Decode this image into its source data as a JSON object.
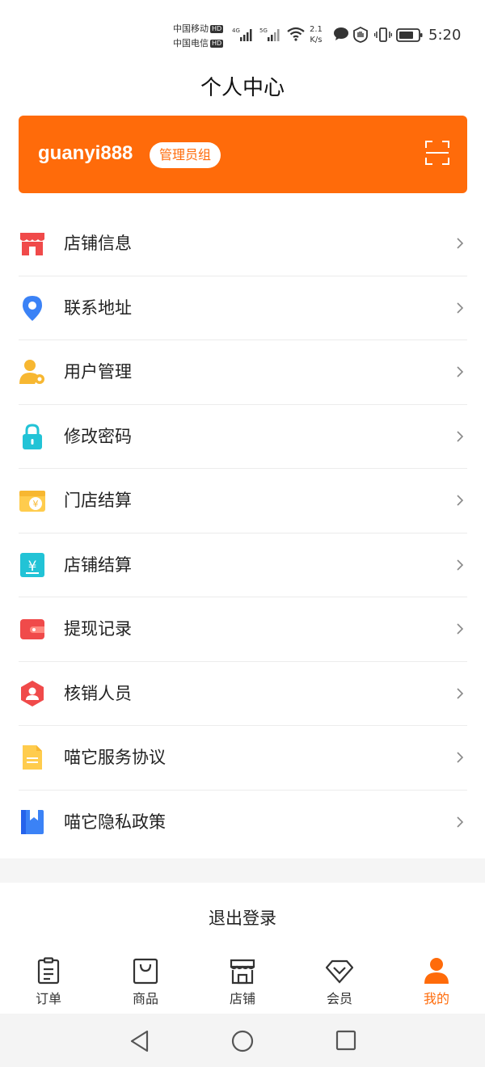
{
  "status_bar": {
    "carrier1": "中国移动",
    "carrier2": "中国电信",
    "hd": "HD",
    "net_4g": "4G",
    "net_5g": "5G",
    "speed_value": "2.1",
    "speed_unit": "K/s",
    "time": "5:20"
  },
  "header": {
    "title": "个人中心"
  },
  "user": {
    "username": "guanyi888",
    "role": "管理员组"
  },
  "menu": {
    "items": [
      {
        "label": "店铺信息",
        "icon": "store-icon"
      },
      {
        "label": "联系地址",
        "icon": "location-pin-icon"
      },
      {
        "label": "用户管理",
        "icon": "user-settings-icon"
      },
      {
        "label": "修改密码",
        "icon": "lock-icon"
      },
      {
        "label": "门店结算",
        "icon": "store-settlement-icon"
      },
      {
        "label": "店铺结算",
        "icon": "yuan-document-icon"
      },
      {
        "label": "提现记录",
        "icon": "wallet-icon"
      },
      {
        "label": "核销人员",
        "icon": "verifier-person-icon"
      },
      {
        "label": "喵它服务协议",
        "icon": "document-icon"
      },
      {
        "label": "喵它隐私政策",
        "icon": "bookmark-book-icon"
      }
    ]
  },
  "logout_label": "退出登录",
  "tabs": [
    {
      "label": "订单",
      "icon": "clipboard-icon",
      "active": false
    },
    {
      "label": "商品",
      "icon": "shopping-bag-icon",
      "active": false
    },
    {
      "label": "店铺",
      "icon": "storefront-icon",
      "active": false
    },
    {
      "label": "会员",
      "icon": "diamond-icon",
      "active": false
    },
    {
      "label": "我的",
      "icon": "person-icon",
      "active": true
    }
  ],
  "colors": {
    "accent": "#ff6b0a",
    "text": "#222222",
    "divider": "#ececec"
  }
}
